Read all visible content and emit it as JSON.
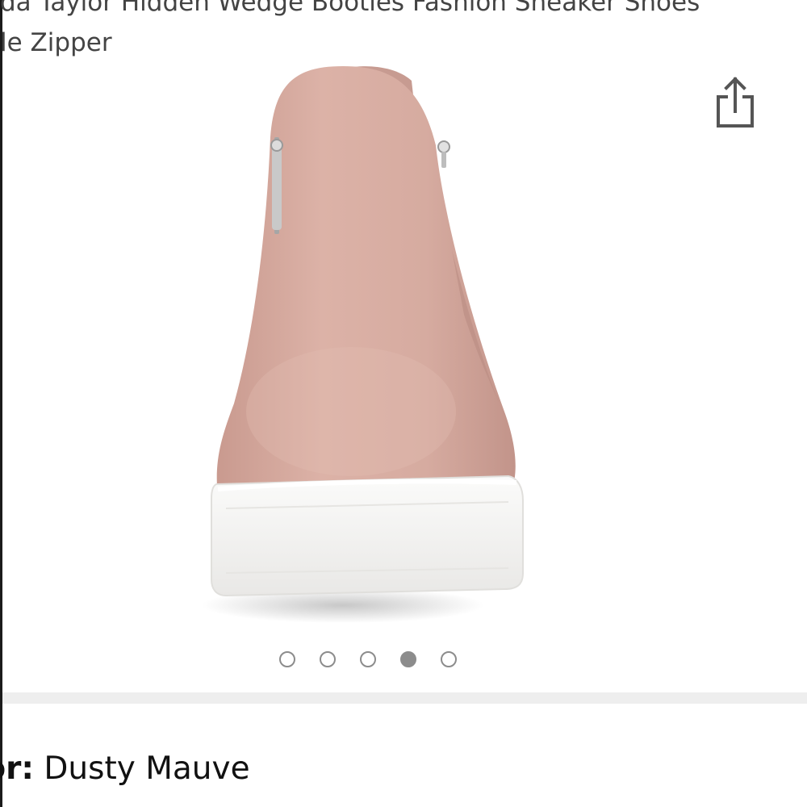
{
  "product": {
    "title": "da Taylor Hidden Wedge Booties Fashion Sneaker Shoes\nle Zipper",
    "image": {
      "subject": "blush suede slip-on wedge sneaker bootie with side zipper and white platform sole",
      "colors": {
        "upper": "#d6aba0",
        "sole": "#f4f3f1",
        "zipper": "#b9b9b9"
      }
    }
  },
  "actions": {
    "share_icon": "share-icon"
  },
  "carousel": {
    "count": 5,
    "active_index": 3
  },
  "color_selector": {
    "label": "lor:",
    "value": "Dusty Mauve"
  }
}
